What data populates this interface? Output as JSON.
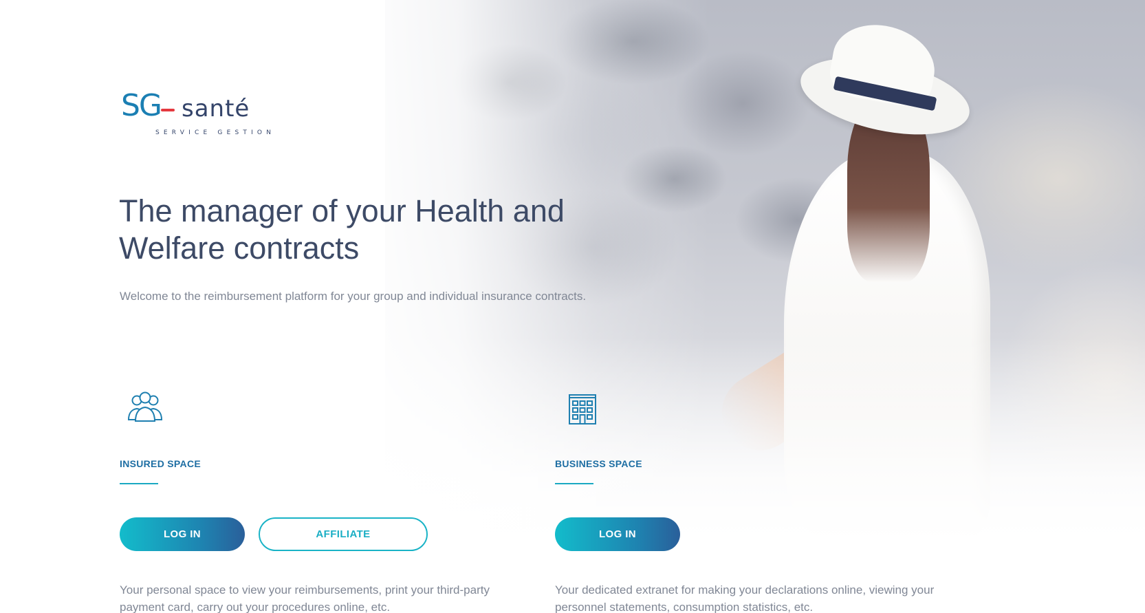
{
  "brand": {
    "logo_sg": "SG",
    "logo_sante": "santé",
    "logo_tagline": "SERVICE GESTION",
    "primary_color": "#1b7fb3",
    "accent_color": "#e4393f",
    "teal_color": "#13bccb"
  },
  "hero": {
    "headline": "The manager of your Health and Welfare contracts",
    "subtitle": "Welcome to the reimbursement platform for your group and individual insurance contracts."
  },
  "insured_space": {
    "icon": "users-icon",
    "title": "INSURED SPACE",
    "login_label": "LOG IN",
    "affiliate_label": "AFFILIATE",
    "description": "Your personal space to view your reimbursements, print your third-party payment card, carry out your procedures online, etc."
  },
  "business_space": {
    "icon": "building-icon",
    "title": "BUSINESS SPACE",
    "login_label": "LOG IN",
    "description": "Your dedicated extranet for making your declarations online, viewing your personnel statements, consumption statistics, etc."
  }
}
